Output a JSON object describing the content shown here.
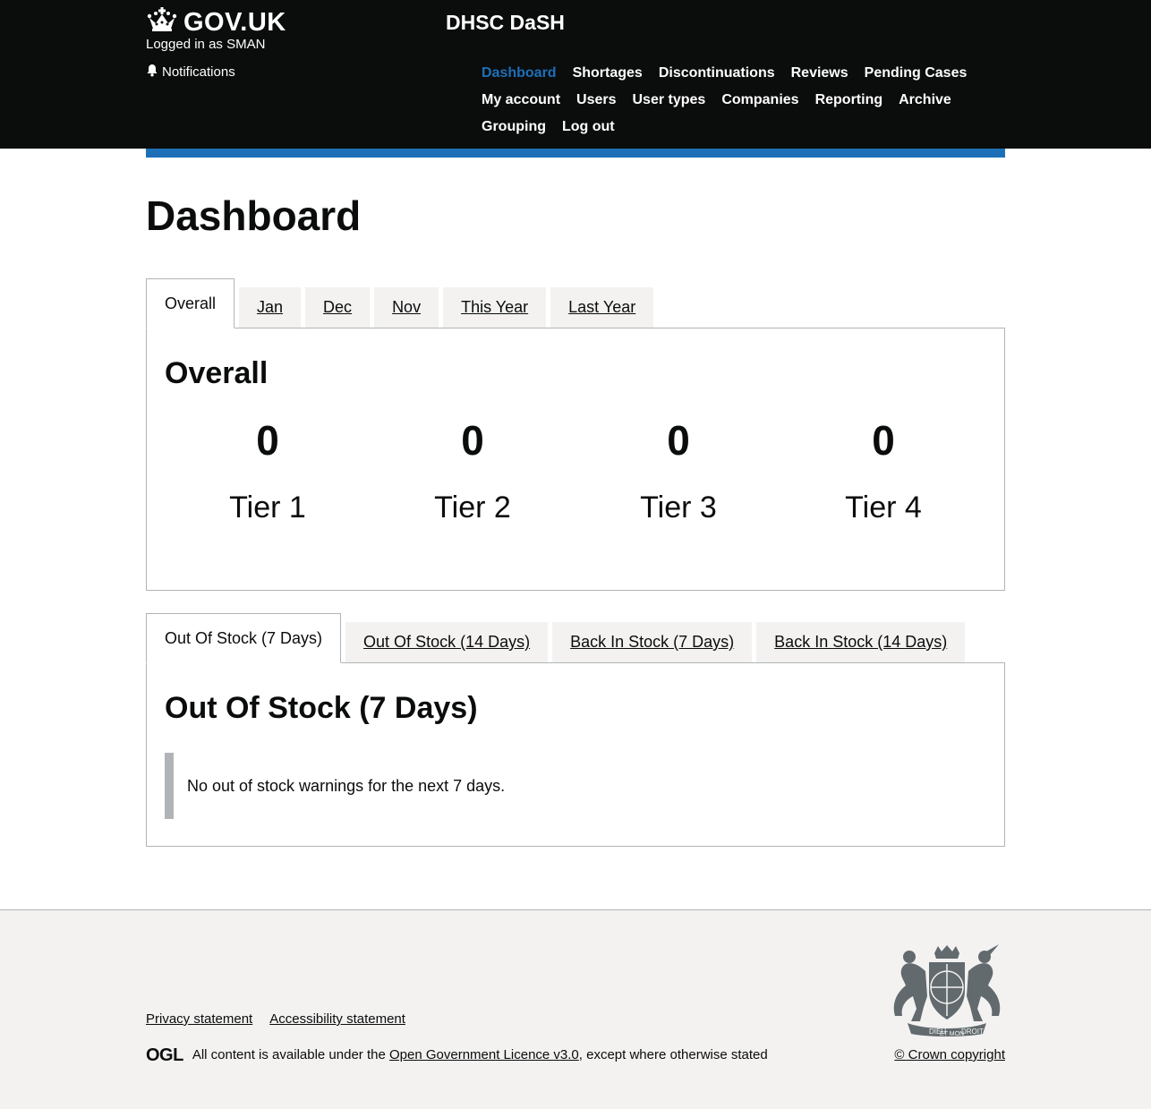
{
  "header": {
    "logo_text": "GOV.UK",
    "logged_in": "Logged in as SMAN",
    "notifications": "Notifications",
    "service_name": "DHSC DaSH",
    "nav": [
      {
        "label": "Dashboard",
        "active": true
      },
      {
        "label": "Shortages"
      },
      {
        "label": "Discontinuations"
      },
      {
        "label": "Reviews"
      },
      {
        "label": "Pending Cases"
      },
      {
        "label": "My account"
      },
      {
        "label": "Users"
      },
      {
        "label": "User types"
      },
      {
        "label": "Companies"
      },
      {
        "label": "Reporting"
      },
      {
        "label": "Archive"
      },
      {
        "label": "Grouping"
      },
      {
        "label": "Log out"
      }
    ]
  },
  "main": {
    "title": "Dashboard",
    "period_tabs": [
      {
        "label": "Overall",
        "selected": true
      },
      {
        "label": "Jan"
      },
      {
        "label": "Dec"
      },
      {
        "label": "Nov"
      },
      {
        "label": "This Year"
      },
      {
        "label": "Last Year"
      }
    ],
    "overall_panel": {
      "title": "Overall",
      "tiers": [
        {
          "count": "0",
          "label": "Tier 1"
        },
        {
          "count": "0",
          "label": "Tier 2"
        },
        {
          "count": "0",
          "label": "Tier 3"
        },
        {
          "count": "0",
          "label": "Tier 4"
        }
      ]
    },
    "stock_tabs": [
      {
        "label": "Out Of Stock (7 Days)",
        "selected": true
      },
      {
        "label": "Out Of Stock (14 Days)"
      },
      {
        "label": "Back In Stock (7 Days)"
      },
      {
        "label": "Back In Stock (14 Days)"
      }
    ],
    "stock_panel": {
      "title": "Out Of Stock (7 Days)",
      "message": "No out of stock warnings for the next 7 days."
    }
  },
  "footer": {
    "links": [
      "Privacy statement",
      "Accessibility statement"
    ],
    "ogl": "OGL",
    "licence_prefix": "All content is available under the ",
    "licence_link": "Open Government Licence v3.0",
    "licence_suffix": ", except where otherwise stated",
    "copyright": "© Crown copyright",
    "crest_motto_left": "DIEU",
    "crest_motto_right": "DROIT",
    "crest_motto_bottom": "ET MON"
  }
}
